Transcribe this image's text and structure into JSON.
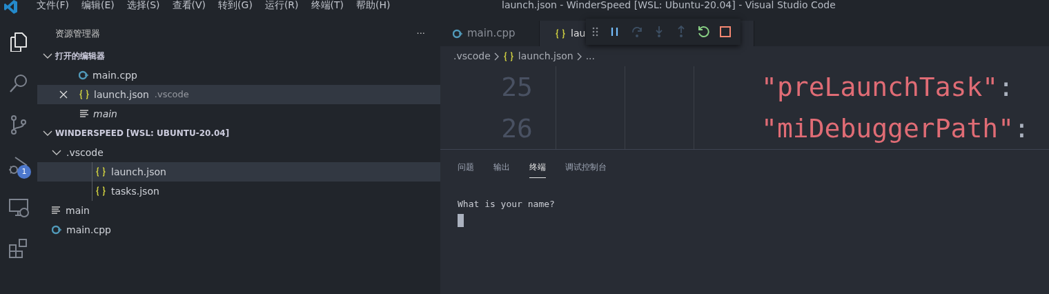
{
  "window": {
    "title": "launch.json - WinderSpeed [WSL: Ubuntu-20.04] - Visual Studio Code"
  },
  "menu": [
    "文件(F)",
    "编辑(E)",
    "选择(S)",
    "查看(V)",
    "转到(G)",
    "运行(R)",
    "终端(T)",
    "帮助(H)"
  ],
  "activity_bar": [
    {
      "kind": "files",
      "selected": true
    },
    {
      "kind": "search",
      "selected": false
    },
    {
      "kind": "source-control",
      "selected": false
    },
    {
      "kind": "debug",
      "selected": false,
      "badge": "1"
    },
    {
      "kind": "remote",
      "selected": false
    },
    {
      "kind": "extensions",
      "selected": false
    }
  ],
  "sidebar": {
    "title": "资源管理器",
    "more": "···",
    "open_editors": {
      "title": "打开的编辑器",
      "expanded": true,
      "items": [
        {
          "name": "main.cpp",
          "kind": "cpp",
          "selected": false,
          "preview": false
        },
        {
          "name": "launch.json",
          "kind": "json",
          "selected": true,
          "preview": false,
          "description": ".vscode"
        },
        {
          "name": "main",
          "kind": "text",
          "selected": false,
          "preview": true
        }
      ]
    },
    "folder": {
      "title": "WINDERSPEED [WSL: UBUNTU-20.04]",
      "expanded": true,
      "items": [
        {
          "name": ".vscode",
          "kind": "folder",
          "expanded": true,
          "selected": false,
          "children": [
            {
              "name": "launch.json",
              "kind": "json",
              "selected": true
            },
            {
              "name": "tasks.json",
              "kind": "json",
              "selected": false
            }
          ]
        },
        {
          "name": "main",
          "kind": "text",
          "selected": false
        },
        {
          "name": "main.cpp",
          "kind": "cpp",
          "selected": false
        }
      ]
    }
  },
  "editor": {
    "tabs": [
      {
        "label": "main.cpp",
        "kind": "cpp",
        "selected": false
      },
      {
        "label": "lau",
        "kind": "json",
        "selected": true
      }
    ],
    "debug_toolbar": [
      {
        "kind": "grip",
        "disabled": false
      },
      {
        "kind": "pause",
        "disabled": false
      },
      {
        "kind": "step-over",
        "disabled": true
      },
      {
        "kind": "step-into",
        "disabled": true
      },
      {
        "kind": "step-out",
        "disabled": true
      },
      {
        "kind": "restart",
        "disabled": false
      },
      {
        "kind": "stop",
        "disabled": false
      }
    ],
    "breadcrumb": [
      {
        "label": ".vscode",
        "kind": "folder"
      },
      {
        "label": "launch.json",
        "kind": "json"
      },
      {
        "label": "...",
        "kind": "more"
      }
    ],
    "lines": [
      {
        "number": "25",
        "key": "\"preLaunchTask\"",
        "punct": ":"
      },
      {
        "number": "26",
        "key": "\"miDebuggerPath\"",
        "punct": ":"
      }
    ]
  },
  "panel": {
    "tabs": [
      {
        "label": "问题",
        "selected": false
      },
      {
        "label": "输出",
        "selected": false
      },
      {
        "label": "终端",
        "selected": true
      },
      {
        "label": "调试控制台",
        "selected": false
      }
    ],
    "terminal": {
      "lines": [
        "What is your name?"
      ],
      "cursor": true
    }
  }
}
